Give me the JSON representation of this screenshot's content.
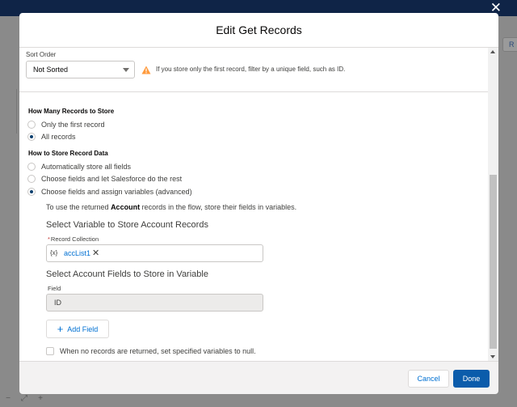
{
  "window": {
    "close_icon": "close-icon"
  },
  "background": {
    "corner_button_label": "R",
    "bottom_controls": [
      "−",
      "⤢",
      "+"
    ]
  },
  "modal": {
    "title": "Edit Get Records",
    "sort": {
      "label": "Sort Order",
      "value": "Not Sorted",
      "warning_icon": "warning-triangle-icon",
      "warning_text": "If you store only the first record, filter by a unique field, such as ID."
    },
    "how_many": {
      "title": "How Many Records to Store",
      "options": [
        {
          "label": "Only the first record",
          "selected": false
        },
        {
          "label": "All records",
          "selected": true
        }
      ]
    },
    "how_store": {
      "title": "How to Store Record Data",
      "options": [
        {
          "label": "Automatically store all fields",
          "selected": false
        },
        {
          "label": "Choose fields and let Salesforce do the rest",
          "selected": false
        },
        {
          "label": "Choose fields and assign variables (advanced)",
          "selected": true
        }
      ]
    },
    "info": {
      "prefix": "To use the returned ",
      "object": "Account",
      "suffix": " records in the flow, store their fields in variables."
    },
    "variable_section": {
      "title": "Select Variable to Store Account Records",
      "field_label": "Record Collection",
      "required_mark": "*",
      "pill_icon": "{x}",
      "pill_value": "accList1"
    },
    "fields_section": {
      "title": "Select Account Fields to Store in Variable",
      "field_label": "Field",
      "field_value": "ID",
      "add_button": "Add Field"
    },
    "null_checkbox": {
      "label": "When no records are returned, set specified variables to null.",
      "checked": false
    },
    "footer": {
      "cancel": "Cancel",
      "done": "Done"
    }
  },
  "colors": {
    "brand": "#0b5cab",
    "link": "#0070d2",
    "warning": "#ff9a3c",
    "header_bar": "#0f2447"
  }
}
